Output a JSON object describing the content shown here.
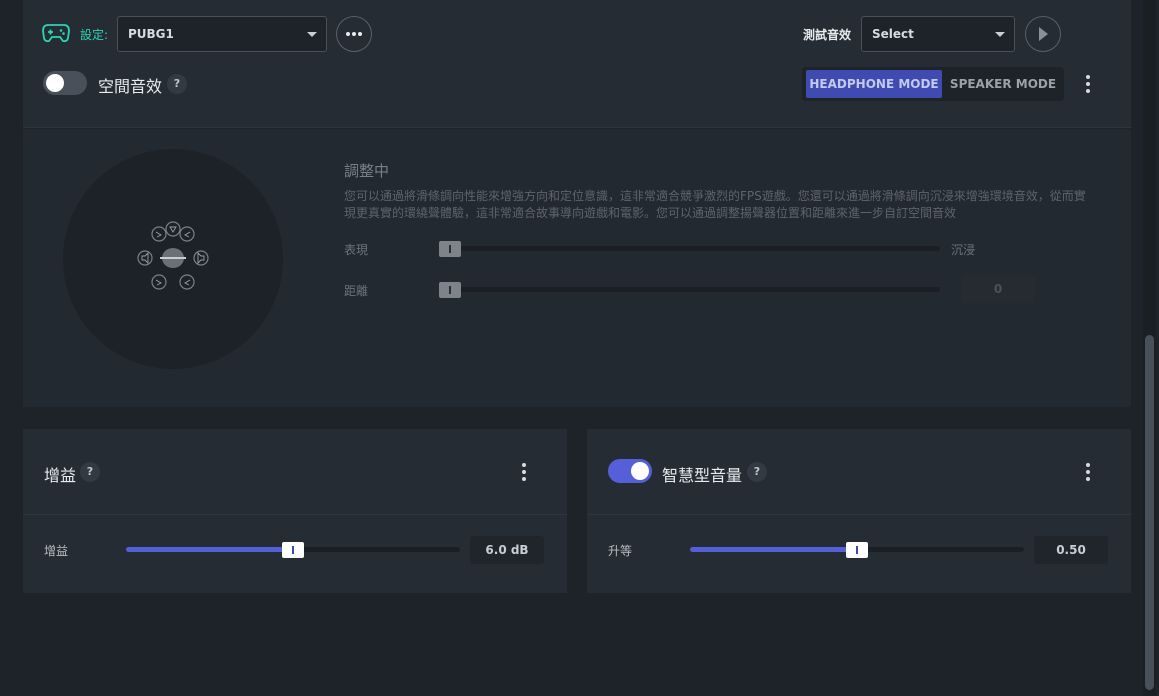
{
  "header": {
    "settings_label": "設定:",
    "profile_value": "PUBG1",
    "test_sound_label": "測試音效",
    "test_sound_value": "Select"
  },
  "spatial": {
    "title": "空間音效",
    "help": "?",
    "enabled": false,
    "modes": [
      "HEADPHONE MODE",
      "SPEAKER MODE"
    ],
    "active_mode": "HEADPHONE MODE",
    "tuning_title": "調整中",
    "description": "您可以通過將滑條調向性能來增強方向和定位意識，這非常適合競爭激烈的FPS遊戲。您還可以通過將滑條調向沉浸來增強環境音效，從而實現更真實的環繞聲體驗，這非常適合故事導向遊戲和電影。您可以通過調整揚聲器位置和距離來進一步自訂空間音效",
    "sliders": [
      {
        "label": "表現",
        "end_label": "沉浸",
        "value": 0
      },
      {
        "label": "距離",
        "value_text": "0",
        "value": 0
      }
    ]
  },
  "gain": {
    "title": "增益",
    "help": "?",
    "slider_label": "增益",
    "value_text": "6.0 dB",
    "level": 0.5
  },
  "smart_volume": {
    "title": "智慧型音量",
    "help": "?",
    "enabled": true,
    "slider_label": "升等",
    "value_text": "0.50",
    "level": 0.5
  },
  "colors": {
    "accent": "#5560d8",
    "settings_teal": "#2cd5b6",
    "panel": "#262c34",
    "background": "#1e232a"
  },
  "icons": [
    "gamepad-icon",
    "more-horizontal-icon",
    "play-icon",
    "help-icon",
    "kebab-menu-icon",
    "speaker-icon"
  ]
}
